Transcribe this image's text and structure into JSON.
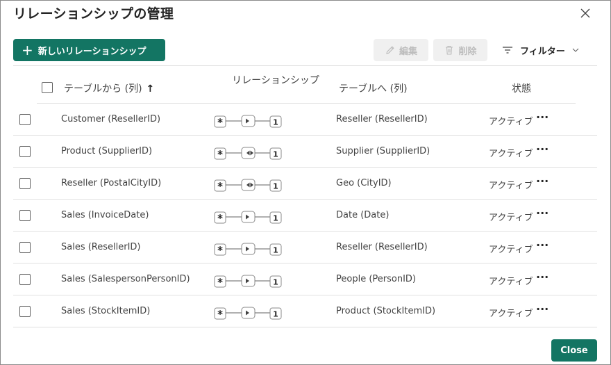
{
  "dialog": {
    "title": "リレーションシップの管理",
    "close_icon": "close-icon"
  },
  "toolbar": {
    "new_label": "新しいリレーションシップ",
    "edit_label": "編集",
    "delete_label": "削除",
    "filter_label": "フィルター"
  },
  "table": {
    "headers": {
      "from": "テーブルから (列)",
      "relationship": "リレーションシップ",
      "to": "テーブルへ (列)",
      "state": "状態"
    },
    "rows": [
      {
        "from": "Customer (ResellerID)",
        "to": "Reseller (ResellerID)",
        "state": "アクティブ",
        "direction": "single",
        "from_card": "*",
        "to_card": "1"
      },
      {
        "from": "Product (SupplierID)",
        "to": "Supplier (SupplierID)",
        "state": "アクティブ",
        "direction": "both",
        "from_card": "*",
        "to_card": "1"
      },
      {
        "from": "Reseller (PostalCityID)",
        "to": "Geo (CityID)",
        "state": "アクティブ",
        "direction": "both",
        "from_card": "*",
        "to_card": "1"
      },
      {
        "from": "Sales (InvoiceDate)",
        "to": "Date (Date)",
        "state": "アクティブ",
        "direction": "single",
        "from_card": "*",
        "to_card": "1"
      },
      {
        "from": "Sales (ResellerID)",
        "to": "Reseller (ResellerID)",
        "state": "アクティブ",
        "direction": "single",
        "from_card": "*",
        "to_card": "1"
      },
      {
        "from": "Sales (SalespersonPersonID)",
        "to": "People (PersonID)",
        "state": "アクティブ",
        "direction": "single",
        "from_card": "*",
        "to_card": "1"
      },
      {
        "from": "Sales (StockItemID)",
        "to": "Product (StockItemID)",
        "state": "アクティブ",
        "direction": "single",
        "from_card": "*",
        "to_card": "1"
      }
    ]
  },
  "footer": {
    "close_label": "Close"
  },
  "colors": {
    "primary": "#137563",
    "disabled_bg": "#f0f0f0",
    "border": "#e0e0e0"
  }
}
